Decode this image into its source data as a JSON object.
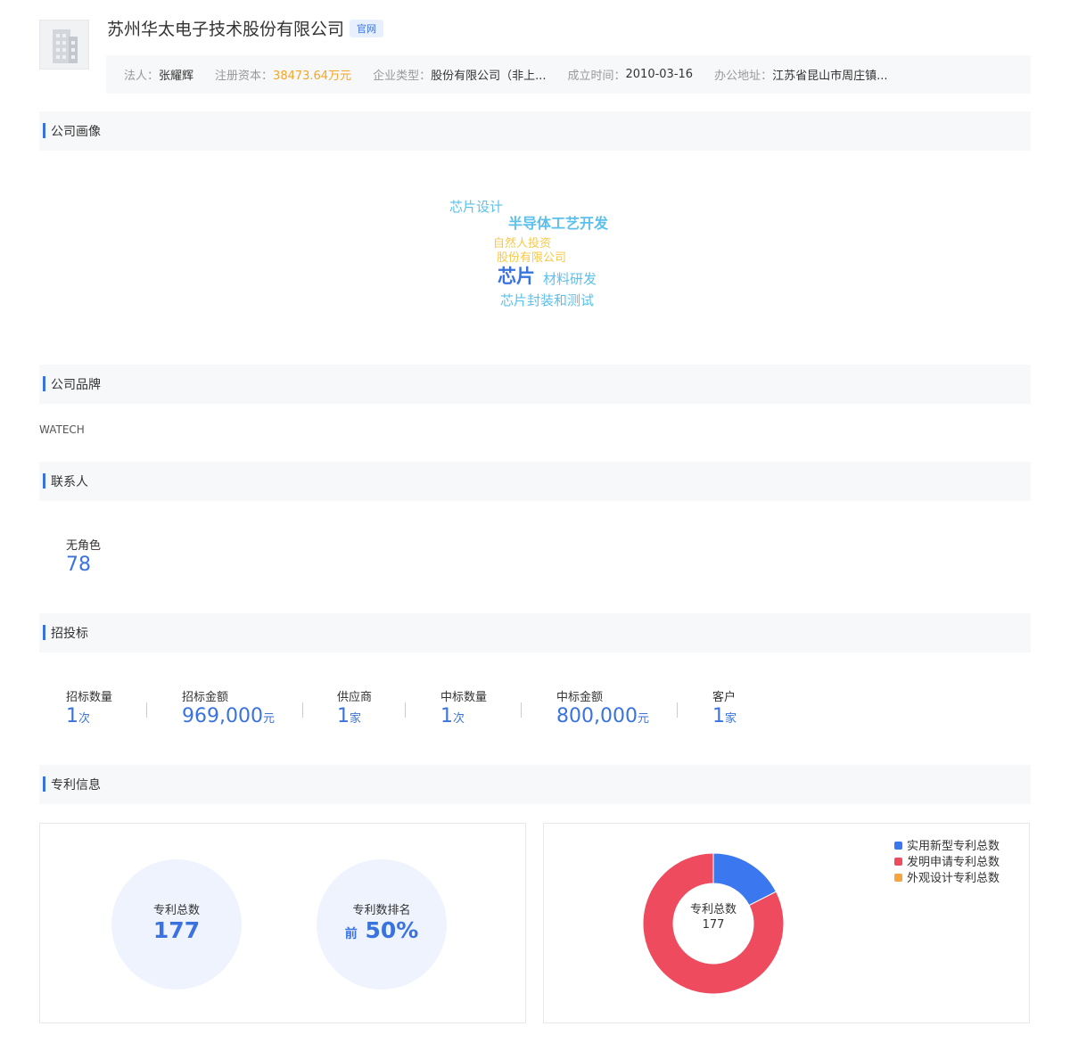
{
  "company": {
    "name": "苏州华太电子技术股份有限公司",
    "official_tag": "官网",
    "info": [
      {
        "label": "法人：",
        "value": "张耀辉"
      },
      {
        "label": "注册资本：",
        "value": "38473.64万元"
      },
      {
        "label": "企业类型：",
        "value": "股份有限公司（非上..."
      },
      {
        "label": "成立时间：",
        "value": "2010-03-16"
      },
      {
        "label": "办公地址：",
        "value": "江苏省昆山市周庄镇..."
      }
    ],
    "colors": {
      "accent": "#3a73e0",
      "money": "#f5a623"
    },
    "logo_icon": "building-icon"
  },
  "sections": {
    "portrait": "公司画像",
    "brand": "公司品牌",
    "contacts": "联系人",
    "bidding": "招投标",
    "patents": "专利信息"
  },
  "wordcloud": {
    "words": [
      {
        "text": "芯片设计",
        "color": "#5bc0eb"
      },
      {
        "text": "半导体工艺开发",
        "color": "#5bc0eb"
      },
      {
        "text": "自然人投资",
        "color": "#f7c948"
      },
      {
        "text": "股份有限公司",
        "color": "#f7c948"
      },
      {
        "text": "芯片",
        "color": "#3a73e0"
      },
      {
        "text": "材料研发",
        "color": "#5bc0eb"
      },
      {
        "text": "芯片封装和测试",
        "color": "#5bc0eb"
      }
    ]
  },
  "brand": {
    "name": "WATECH"
  },
  "contacts": {
    "label": "无角色",
    "count": "78"
  },
  "bidding": {
    "items": [
      {
        "label": "招标数量",
        "value": "1",
        "unit": "次"
      },
      {
        "label": "招标金额",
        "value": "969,000",
        "unit": "元"
      },
      {
        "label": "供应商",
        "value": "1",
        "unit": "家"
      },
      {
        "label": "中标数量",
        "value": "1",
        "unit": "次"
      },
      {
        "label": "中标金额",
        "value": "800,000",
        "unit": "元"
      },
      {
        "label": "客户",
        "value": "1",
        "unit": "家"
      }
    ]
  },
  "patents": {
    "total_label": "专利总数",
    "total": "177",
    "rank_label": "专利数排名",
    "rank_prefix": "前",
    "rank_value": "50%"
  },
  "chart_data": {
    "type": "pie",
    "center_label": "专利总数",
    "center_value": "177",
    "legend_position": "top-right",
    "series": [
      {
        "name": "实用新型专利总数",
        "value": 31,
        "color": "#3b78f0"
      },
      {
        "name": "发明申请专利总数",
        "value": 146,
        "color": "#ee4b5f"
      },
      {
        "name": "外观设计专利总数",
        "value": 0,
        "color": "#f5a440"
      }
    ]
  }
}
